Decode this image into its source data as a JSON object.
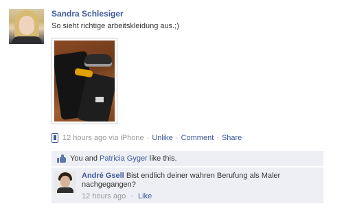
{
  "post": {
    "author": "Sandra Schlesiger",
    "message": "So sieht richtige arbeitskleidung aus.;)",
    "meta": {
      "time": "12 hours ago via iPhone",
      "unlike": "Unlike",
      "comment": "Comment",
      "share": "Share",
      "separator": "·"
    },
    "likes": {
      "prefix": "You and ",
      "name": "Patricia Gyger",
      "suffix": " like this."
    },
    "comments": [
      {
        "author": "André Gsell",
        "text": "Bist endlich deiner wahren Berufung als Maler nachgegangen?",
        "time": "12 hours ago",
        "like": "Like",
        "separator": "·"
      }
    ]
  },
  "icons": {
    "source": "iphone-icon",
    "like": "thumbs-up-icon"
  },
  "colors": {
    "link": "#3b5998",
    "meta": "#999999",
    "box": "#edeff4"
  }
}
